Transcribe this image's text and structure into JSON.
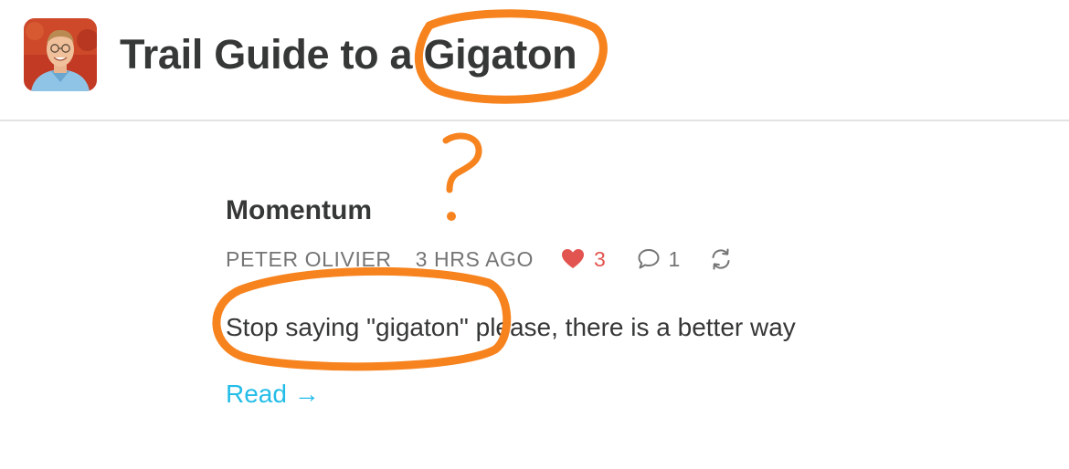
{
  "header": {
    "publication_title": "Trail Guide to a Gigaton"
  },
  "post": {
    "title": "Momentum",
    "author": "PETER OLIVIER",
    "date": "3 HRS AGO",
    "like_count": "3",
    "comment_count": "1",
    "subtitle": "Stop saying \"gigaton\" please, there is a better way",
    "read_link": "Read →"
  },
  "annotations": {
    "question_mark": "?"
  },
  "colors": {
    "title_text": "#363737",
    "meta_text": "#757575",
    "like": "#e2544f",
    "link": "#23bde8",
    "annotation": "#f7831e",
    "divider": "#e3e3e3"
  }
}
